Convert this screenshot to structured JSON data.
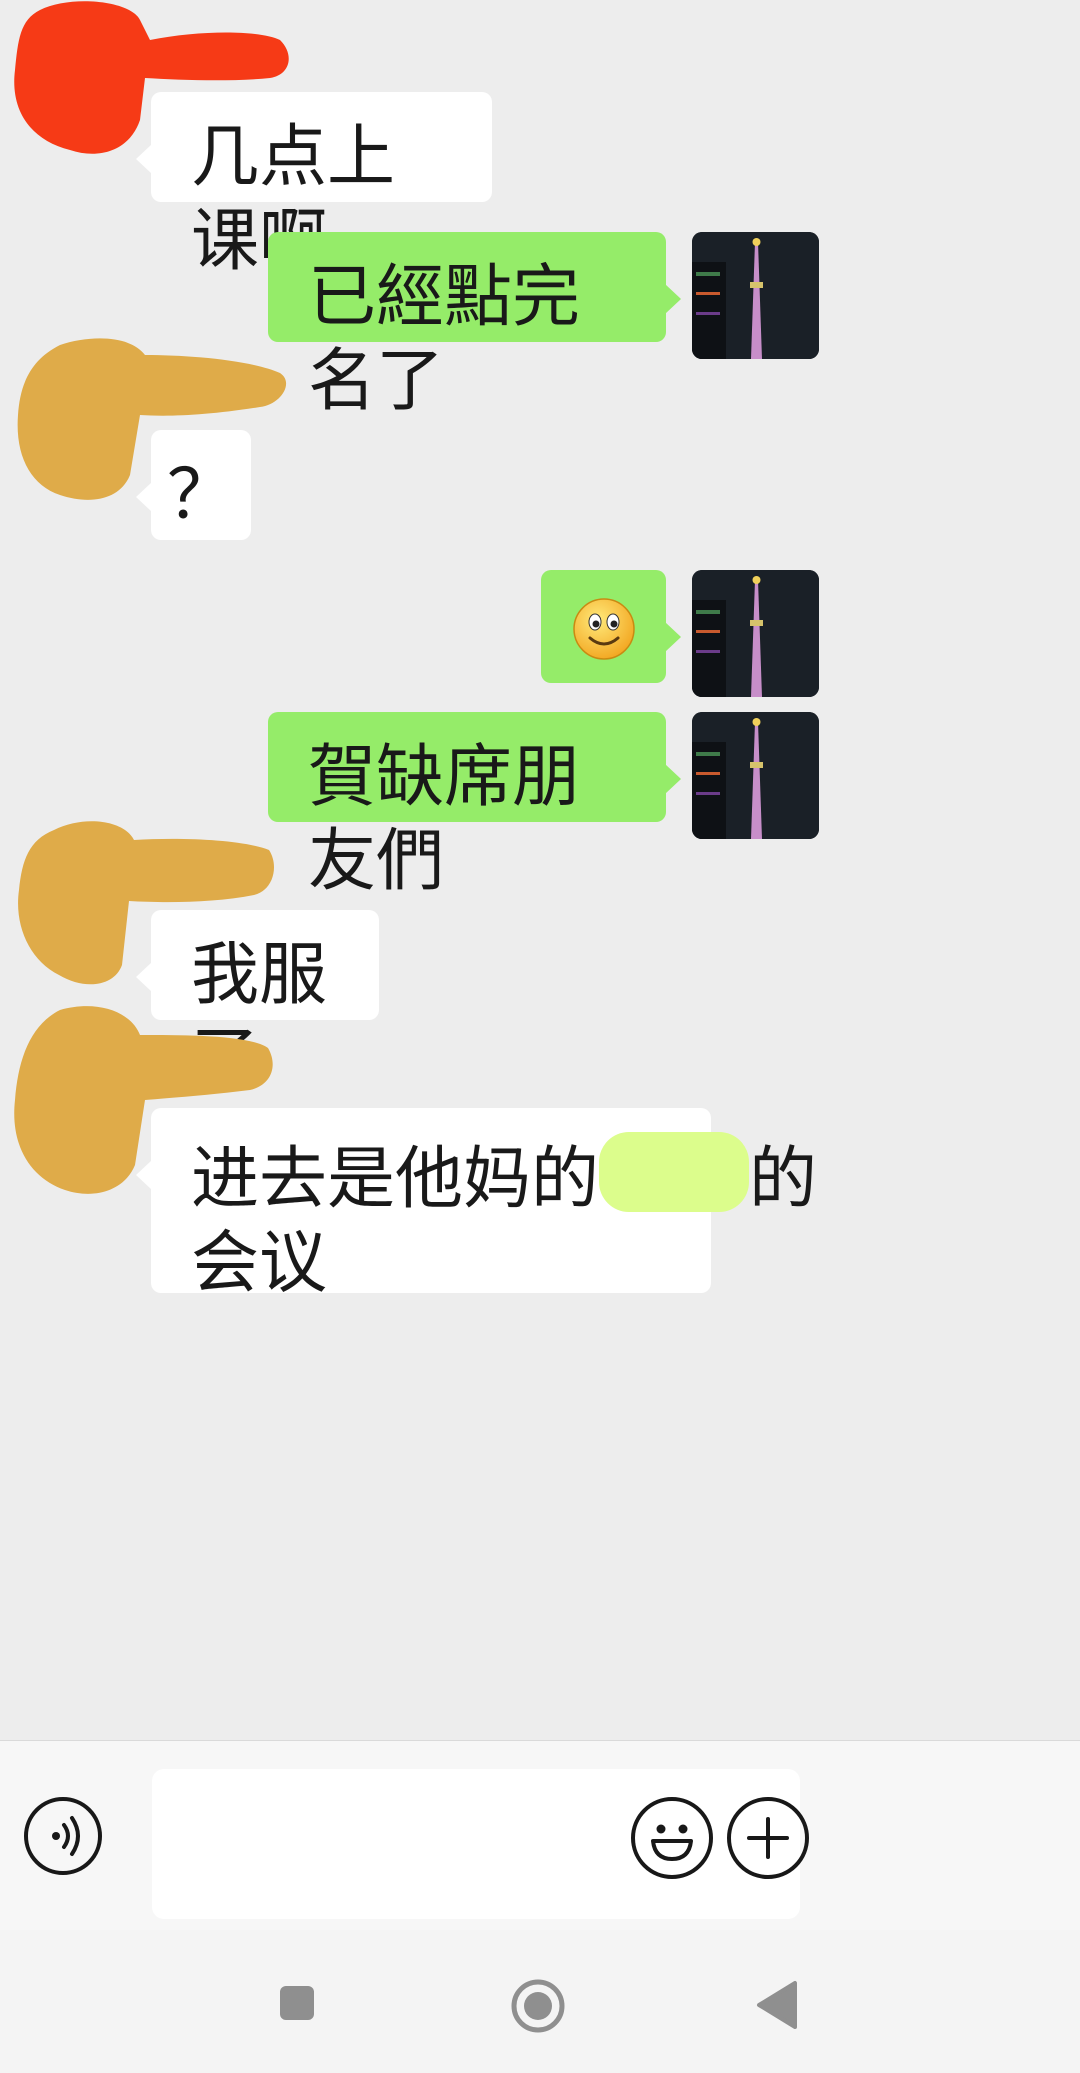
{
  "conversation": {
    "messages": [
      {
        "side": "in",
        "text": "几点上课啊"
      },
      {
        "side": "out",
        "text": "已經點完名了"
      },
      {
        "side": "in",
        "text": "？"
      },
      {
        "side": "out",
        "emoji": "smiley"
      },
      {
        "side": "out",
        "text": "賀缺席朋友們"
      },
      {
        "side": "in",
        "text": "我服了"
      },
      {
        "side": "in",
        "text_before_redaction": "进去是他妈的",
        "text_after_redaction": "的",
        "text_line2": "会议"
      }
    ]
  },
  "input_bar": {
    "voice_icon": "voice-icon",
    "emoji_icon": "emoji-icon",
    "plus_icon": "plus-icon",
    "text_value": ""
  },
  "navbar": {
    "icons": [
      "recents-square-icon",
      "home-circle-icon",
      "back-triangle-icon"
    ]
  },
  "colors": {
    "incoming_bubble": "#ffffff",
    "outgoing_bubble": "#95ec69",
    "background": "#ededed",
    "scribble_red": "#f63a16",
    "scribble_gold": "#dfab49",
    "redaction_green": "#dcfd8c"
  }
}
